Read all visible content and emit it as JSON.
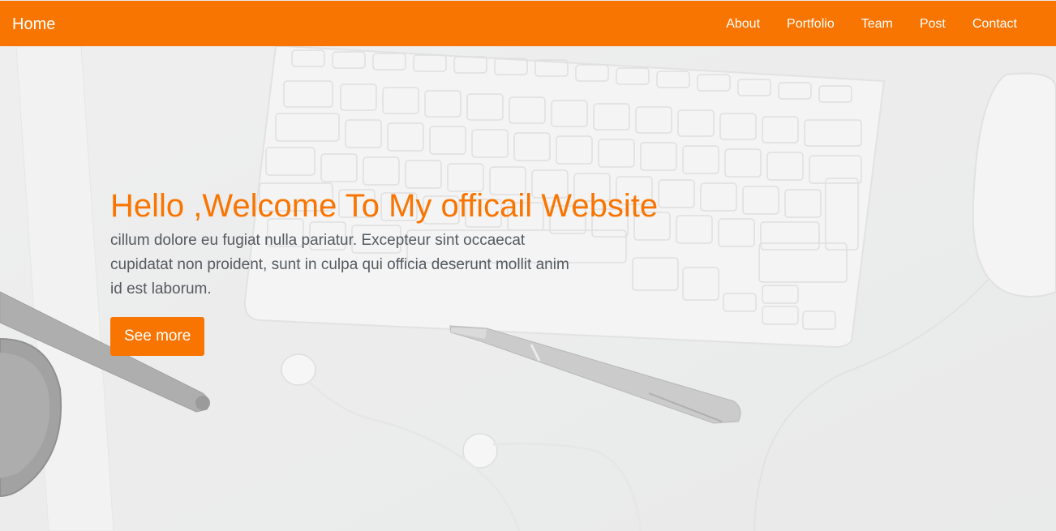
{
  "navbar": {
    "brand": "Home",
    "links": [
      "About",
      "Portfolio",
      "Team",
      "Post",
      "Contact"
    ]
  },
  "hero": {
    "title": "Hello ,Welcome To My officail Website",
    "text": "cillum dolore eu fugiat nulla pariatur. Excepteur sint occaecat cupidatat non proident, sunt in culpa qui officia deserunt mollit anim id est laborum.",
    "button_label": "See more"
  },
  "colors": {
    "accent": "#f97502",
    "background": "#eceded",
    "body_text": "#555a5f"
  },
  "background_image": {
    "icons": [
      "keyboard-icon",
      "mouse-icon",
      "pen-icon",
      "pencil-icon",
      "earphones-icon",
      "lens-cap-icon"
    ]
  }
}
